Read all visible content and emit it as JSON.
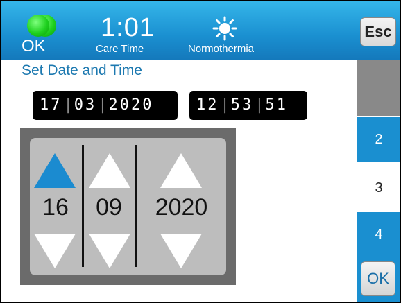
{
  "status": {
    "ok_label": "OK",
    "time": "1:01",
    "time_caption": "Care Time",
    "therm_caption": "Normothermia",
    "esc_label": "Esc"
  },
  "page": {
    "title": "Set Date and Time"
  },
  "current_date": {
    "day": "17",
    "month": "03",
    "year": "2020"
  },
  "current_time": {
    "hour": "12",
    "minute": "53",
    "second": "51"
  },
  "picker": {
    "day": "16",
    "month": "09",
    "year": "2020"
  },
  "side": {
    "tab2": "2",
    "tab3": "3",
    "tab4": "4",
    "ok_label": "OK"
  },
  "colors": {
    "accent": "#1a8fd0",
    "led": "#1fd11f",
    "panel": "#bdbdbd"
  },
  "icons": [
    "status-led-icon",
    "sun-icon",
    "up-arrow-icon",
    "down-arrow-icon"
  ]
}
